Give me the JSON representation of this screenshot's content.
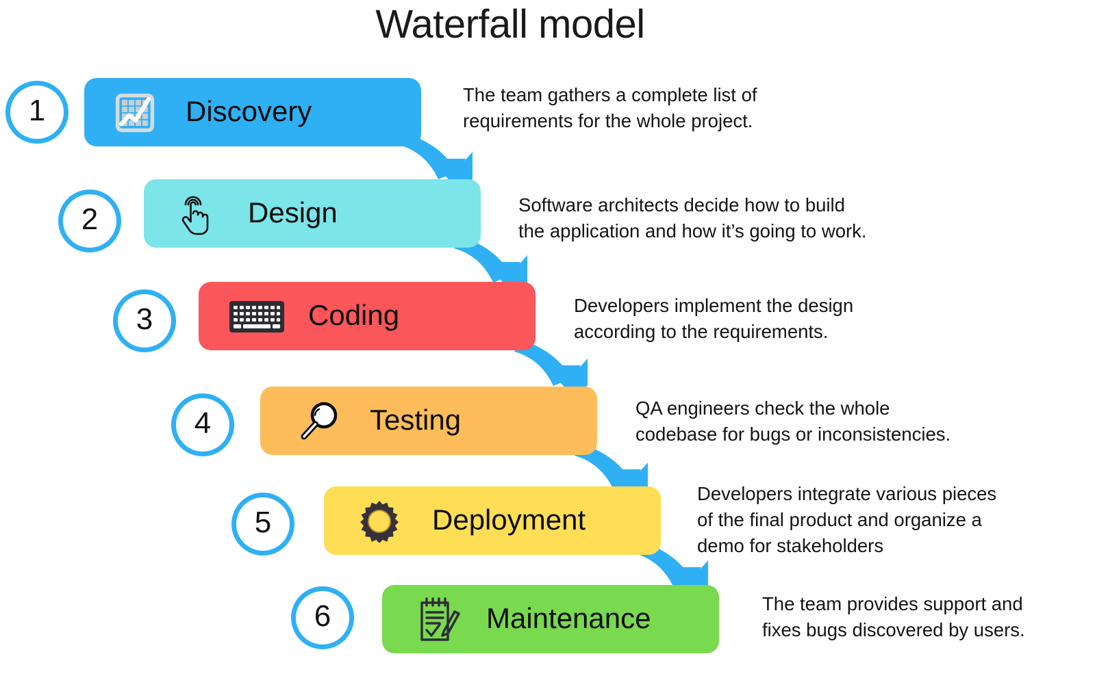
{
  "title": "Waterfall model",
  "theme": {
    "accent_blue": "#2fb0f5",
    "background": "#ffffff",
    "text": "#141414"
  },
  "steps": [
    {
      "number": "1",
      "label": "Discovery",
      "icon": "chart-trend-icon",
      "color": "#2fb0f5",
      "description": "The team gathers a complete list of\nrequirements for the whole project."
    },
    {
      "number": "2",
      "label": "Design",
      "icon": "tap-hand-icon",
      "color": "#7ce5e9",
      "description": "Software architects decide how to build\nthe application and how it’s going to work."
    },
    {
      "number": "3",
      "label": "Coding",
      "icon": "keyboard-icon",
      "color": "#fb5659",
      "description": "Developers implement the design\naccording to the requirements."
    },
    {
      "number": "4",
      "label": "Testing",
      "icon": "magnifier-icon",
      "color": "#febd5a",
      "description": "QA engineers check the whole\ncodebase for bugs or inconsistencies."
    },
    {
      "number": "5",
      "label": "Deployment",
      "icon": "gear-icon",
      "color": "#ffde55",
      "description": "Developers integrate various pieces\nof the final product and organize a\ndemo for stakeholders"
    },
    {
      "number": "6",
      "label": "Maintenance",
      "icon": "notepad-pencil-icon",
      "color": "#79d94f",
      "description": "The team provides support and\nfixes bugs discovered by users."
    }
  ]
}
